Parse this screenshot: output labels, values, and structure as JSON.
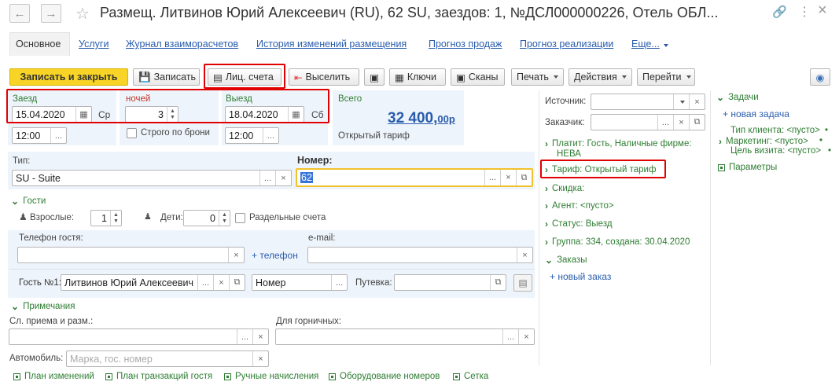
{
  "window": {
    "title": "Размещ. Литвинов Юрий Алексеевич (RU), 62 SU, заездов: 1, №ДСЛ000000226, Отель ОБЛ...",
    "back_icon": "arrow-left-icon",
    "forward_icon": "arrow-right-icon",
    "star_icon": "star-icon",
    "link_icon": "link-icon",
    "more": "⋮",
    "close": "×"
  },
  "tabs": [
    {
      "label": "Основное"
    },
    {
      "label": "Услуги"
    },
    {
      "label": "Журнал взаиморасчетов"
    },
    {
      "label": "История изменений размещения"
    },
    {
      "label": "Прогноз продаж"
    },
    {
      "label": "Прогноз реализации"
    },
    {
      "label": "Еще..."
    }
  ],
  "toolbar": {
    "save_close": "Записать и закрыть",
    "save": "Записать",
    "accounts": "Лиц. счета",
    "checkout": "Выселить",
    "keys": "Ключи",
    "scans": "Сканы",
    "print": "Печать",
    "actions": "Действия",
    "goto": "Перейти"
  },
  "stay": {
    "checkin_label": "Заезд",
    "checkin_date": "15.04.2020",
    "checkin_dow": "Ср",
    "checkin_time": "12:00",
    "nights_label": "ночей",
    "nights": "3",
    "strict_label": "Строго по брони",
    "checkout_label": "Выезд",
    "checkout_date": "18.04.2020",
    "checkout_dow": "Сб",
    "checkout_time": "12:00",
    "total_label": "Всего",
    "total_main": "32 400,",
    "total_cents": "00р",
    "tariff_label": "Открытый тариф"
  },
  "room": {
    "type_label": "Тип:",
    "type_value": "SU - Suite",
    "number_label": "Номер:",
    "number_value": "62"
  },
  "guests": {
    "section": "Гости",
    "adults_label": "Взрослые:",
    "adults": "1",
    "children_label": "Дети:",
    "children": "0",
    "separate_label": "Раздельные счета",
    "phone_label": "Телефон гостя:",
    "phone_value": "",
    "add_phone": "+ телефон",
    "email_label": "e-mail:",
    "email_value": "",
    "guest_label": "Гость №1:",
    "guest_value": "Литвинов Юрий Алексеевич",
    "room_placeholder": "Номер",
    "voucher_label": "Путевка:",
    "voucher_value": ""
  },
  "notes": {
    "section": "Примечания",
    "reception_label": "Сл. приема и разм.:",
    "maids_label": "Для горничных:",
    "car_label": "Автомобиль:",
    "car_placeholder": "Марка, гос. номер"
  },
  "side": {
    "source_label": "Источник:",
    "customer_label": "Заказчик:",
    "payer": "Платит: Гость, Наличные фирме:",
    "payer2": "НЕВА",
    "tariff": "Тариф: Открытый тариф",
    "discount": "Скидка:",
    "agent": "Агент: <пусто>",
    "status": "Статус: Выезд",
    "group": "Группа: 334, создана: 30.04.2020",
    "orders": "Заказы",
    "new_order": "+ новый заказ"
  },
  "tasks": {
    "section": "Задачи",
    "new_task": "+ новая задача",
    "client_type": "Тип клиента: <пусто>",
    "marketing": "Маркетинг: <пусто>",
    "purpose": "Цель визита: <пусто>",
    "params": "Параметры"
  },
  "footer": [
    {
      "label": "План изменений"
    },
    {
      "label": "План транзакций гостя"
    },
    {
      "label": "Ручные начисления"
    },
    {
      "label": "Оборудование номеров"
    },
    {
      "label": "Сетка"
    }
  ],
  "colors": {
    "accent_yellow": "#f7d425",
    "link_blue": "#2a5cac",
    "green": "#2e7d32",
    "highlight": "#e00000"
  }
}
